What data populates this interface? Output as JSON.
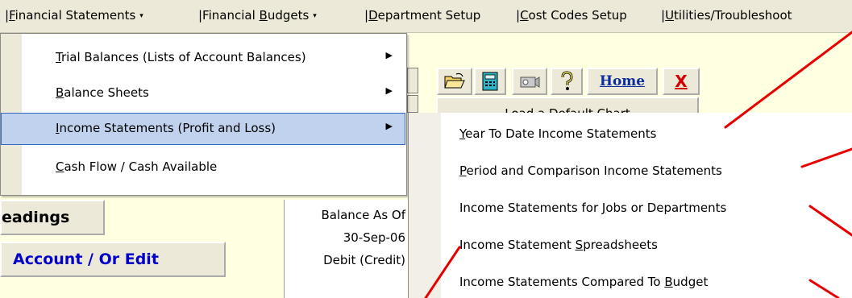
{
  "menubar": {
    "items": [
      {
        "pre": "|",
        "key": "F",
        "post": "inancial Statements",
        "caret": "▾"
      },
      {
        "pre": "|Financial ",
        "key": "B",
        "post": "udgets",
        "caret": "▾"
      },
      {
        "pre": "|",
        "key": "D",
        "post": "epartment Setup",
        "caret": ""
      },
      {
        "pre": "|",
        "key": "C",
        "post": "ost Codes Setup",
        "caret": ""
      },
      {
        "pre": "|",
        "key": "U",
        "post": "tilities/Troubleshoot",
        "caret": ""
      }
    ]
  },
  "fs_menu": {
    "items": [
      {
        "pre": "",
        "key": "T",
        "post": "rial Balances (Lists of Account Balances)",
        "arrow": "▶",
        "highlighted": false
      },
      {
        "pre": "",
        "key": "B",
        "post": "alance Sheets",
        "arrow": "▶",
        "highlighted": false
      },
      {
        "pre": "",
        "key": "I",
        "post": "ncome Statements (Profit and Loss)",
        "arrow": "▶",
        "highlighted": true
      },
      {
        "pre": "",
        "key": "C",
        "post": "ash Flow / Cash Available",
        "arrow": "",
        "highlighted": false
      }
    ]
  },
  "submenu": {
    "items": [
      {
        "pre": "",
        "key": "Y",
        "post": "ear To Date Income Statements"
      },
      {
        "pre": "",
        "key": "P",
        "post": "eriod and Comparison Income Statements"
      },
      {
        "pre": "Income Statements for ",
        "key": "J",
        "post": "obs or Departments"
      },
      {
        "pre": "Income Statement ",
        "key": "S",
        "post": "preadsheets"
      },
      {
        "pre": "Income Statements Compared To ",
        "key": "B",
        "post": "udget"
      }
    ]
  },
  "toolbar": {
    "home_label": "Home",
    "close_label": "X",
    "load_chart_label": "Load a Default Chart"
  },
  "left": {
    "headings_label": "eadings",
    "account_label": "Account / Or Edit"
  },
  "balance": {
    "line1": "Balance As Of",
    "line2": "30-Sep-06",
    "line3": "Debit (Credit)"
  },
  "colors": {
    "annotation": "#e60000",
    "highlight": "#c1d2ee",
    "app_background": "#ffffe1"
  }
}
